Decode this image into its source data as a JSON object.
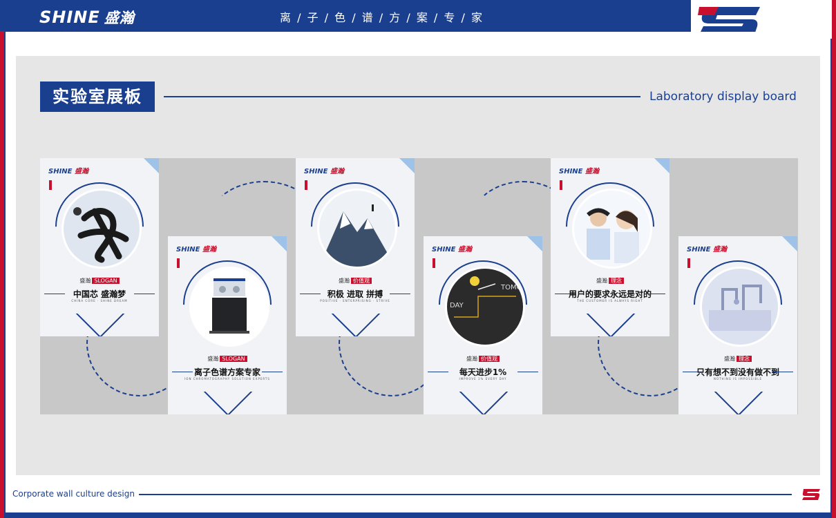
{
  "header": {
    "brand_en": "SHINE",
    "brand_cn": "盛瀚",
    "title": "离 / 子 / 色 / 谱 / 方 / 案 / 专 / 家"
  },
  "section": {
    "badge": "实验室展板",
    "title_en": "Laboratory display board"
  },
  "footer": {
    "text": "Corporate wall culture design"
  },
  "posters": [
    {
      "logo_en": "SHINE",
      "logo_cn": "盛瀚",
      "tag_prefix": "盛瀚",
      "tag_label": "SLOGAN",
      "slogan": "中国芯 盛瀚梦",
      "sub": "CHINA CORE · SHINE DREAM"
    },
    {
      "logo_en": "SHINE",
      "logo_cn": "盛瀚",
      "tag_prefix": "盛瀚",
      "tag_label": "SLOGAN",
      "slogan": "离子色谱方案专家",
      "sub": "ION CHROMATOGRAPHY SOLUTION EXPERTS"
    },
    {
      "logo_en": "SHINE",
      "logo_cn": "盛瀚",
      "tag_prefix": "盛瀚",
      "tag_label": "价值观",
      "slogan": "积极 进取 拼搏",
      "sub": "POSITIVE · ENTERPRISING · STRIVE"
    },
    {
      "logo_en": "SHINE",
      "logo_cn": "盛瀚",
      "tag_prefix": "盛瀚",
      "tag_label": "价值观",
      "slogan": "每天进步1%",
      "sub": "IMPROVE 1% EVERY DAY",
      "chalk_left": "DAY",
      "chalk_right": "TOMO"
    },
    {
      "logo_en": "SHINE",
      "logo_cn": "盛瀚",
      "tag_prefix": "盛瀚",
      "tag_label": "理念",
      "slogan": "用户的要求永远是对的",
      "sub": "THE CUSTOMER IS ALWAYS RIGHT"
    },
    {
      "logo_en": "SHINE",
      "logo_cn": "盛瀚",
      "tag_prefix": "盛瀚",
      "tag_label": "理念",
      "slogan": "只有想不到没有做不到",
      "sub": "NOTHING IS IMPOSSIBLE"
    }
  ],
  "colors": {
    "brand_blue": "#1b3f8f",
    "accent_red": "#c8102e"
  }
}
